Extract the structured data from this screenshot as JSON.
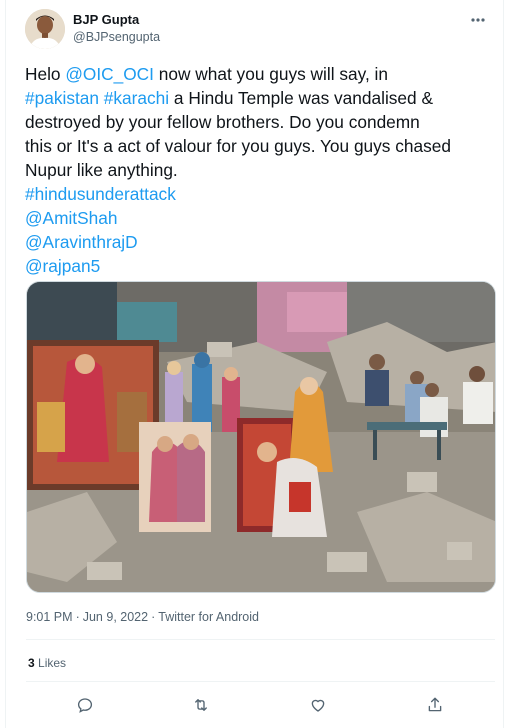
{
  "author": {
    "name": "BJP Gupta",
    "handle": "@BJPsengupta"
  },
  "tweet": {
    "lines": [
      [
        {
          "t": "Helo ",
          "link": false
        },
        {
          "t": "@OIC_OCI",
          "link": true
        },
        {
          "t": " now what you guys will say, in",
          "link": false
        }
      ],
      [
        {
          "t": "#pakistan",
          "link": true
        },
        {
          "t": " ",
          "link": false
        },
        {
          "t": "#karachi",
          "link": true
        },
        {
          "t": " a Hindu Temple was vandalised &",
          "link": false
        }
      ],
      [
        {
          "t": "destroyed by your fellow brothers. Do you condemn",
          "link": false
        }
      ],
      [
        {
          "t": "this or It's a act of valour for you guys. You guys chased",
          "link": false
        }
      ],
      [
        {
          "t": "Nupur like anything.",
          "link": false
        }
      ],
      [
        {
          "t": "#hindusunderattack",
          "link": true
        }
      ],
      [
        {
          "t": "@AmitShah",
          "link": true
        }
      ],
      [
        {
          "t": "@AravinthrajD",
          "link": true
        }
      ],
      [
        {
          "t": "@rajpan5",
          "link": true
        }
      ]
    ]
  },
  "meta": {
    "time": "9:01 PM",
    "date": "Jun 9, 2022",
    "separator": "·",
    "source": "Twitter for Android"
  },
  "stats": {
    "likes_count": "3",
    "likes_label": "Likes"
  },
  "icons": {
    "more": "more-horizontal-icon",
    "reply": "reply-icon",
    "retweet": "retweet-icon",
    "like": "heart-icon",
    "share": "share-icon"
  },
  "colors": {
    "link": "#1d9bf0",
    "secondary_text": "#536471",
    "primary_text": "#0f1419",
    "divider": "#eff3f4"
  }
}
